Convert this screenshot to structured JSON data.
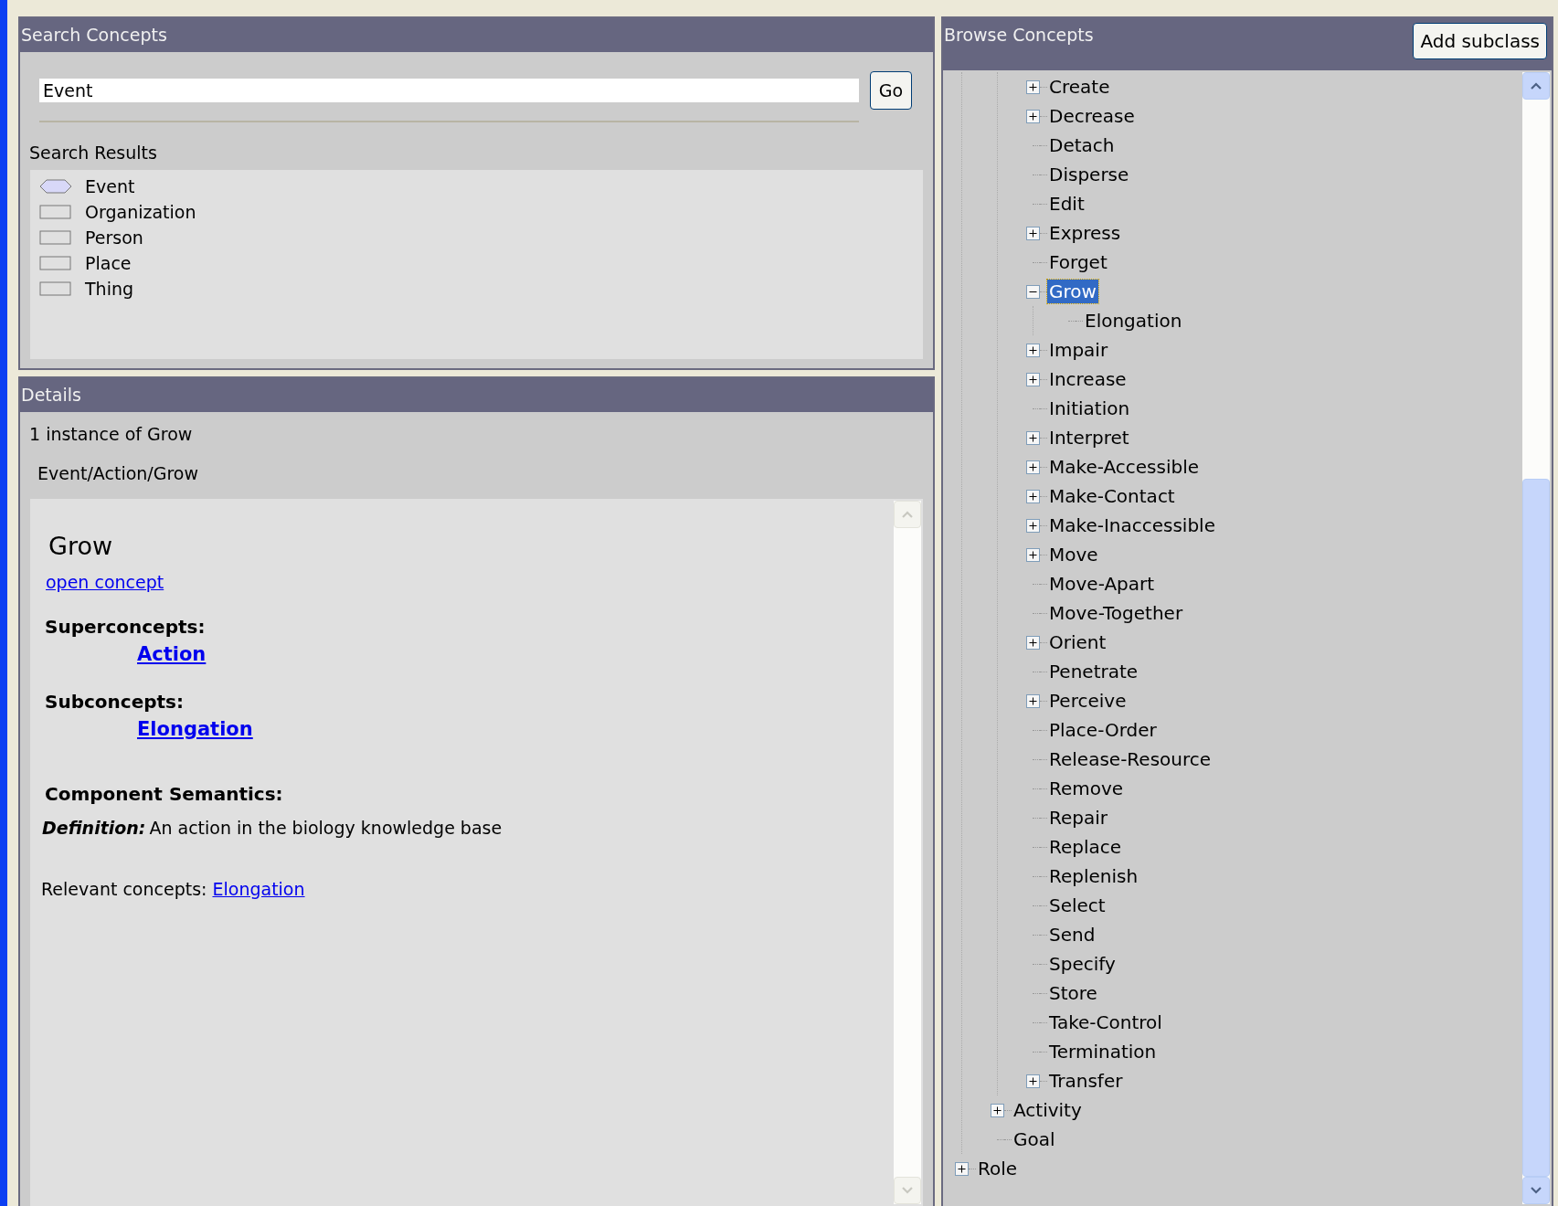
{
  "search_panel": {
    "title": "Search Concepts",
    "query": "Event",
    "go_button": "Go",
    "results_label": "Search Results",
    "results": [
      {
        "label": "Event",
        "kind": "event"
      },
      {
        "label": "Organization",
        "kind": "class"
      },
      {
        "label": "Person",
        "kind": "class"
      },
      {
        "label": "Place",
        "kind": "class"
      },
      {
        "label": "Thing",
        "kind": "class"
      }
    ]
  },
  "details_panel": {
    "title": "Details",
    "instance_count": "1 instance of Grow",
    "path": "Event/Action/Grow",
    "concept": {
      "name": "Grow",
      "open_link": "open concept",
      "superconcepts_label": "Superconcepts:",
      "superconcepts": [
        "Action"
      ],
      "subconcepts_label": "Subconcepts:",
      "subconcepts": [
        "Elongation"
      ],
      "semantics_label": "Component Semantics:",
      "definition_label": "Definition:",
      "definition": "An action in the biology knowledge base",
      "relevant_label": "Relevant concepts:",
      "relevant": [
        "Elongation"
      ]
    }
  },
  "browse_panel": {
    "title": "Browse Concepts",
    "add_button": "Add subclass",
    "tree": [
      {
        "children": [
          {
            "children": [
              {
                "label": "Create",
                "kind": "branch",
                "expanded": false,
                "selected": false
              },
              {
                "label": "Decrease",
                "kind": "branch",
                "expanded": false,
                "selected": false
              },
              {
                "label": "Detach",
                "kind": "leaf",
                "selected": false
              },
              {
                "label": "Disperse",
                "kind": "leaf",
                "selected": false
              },
              {
                "label": "Edit",
                "kind": "leaf",
                "selected": false
              },
              {
                "label": "Express",
                "kind": "branch",
                "expanded": false,
                "selected": false
              },
              {
                "label": "Forget",
                "kind": "leaf",
                "selected": false
              },
              {
                "label": "Grow",
                "kind": "branch",
                "expanded": true,
                "selected": true,
                "children": [
                  {
                    "label": "Elongation",
                    "kind": "leaf",
                    "selected": false
                  }
                ]
              },
              {
                "label": "Impair",
                "kind": "branch",
                "expanded": false,
                "selected": false
              },
              {
                "label": "Increase",
                "kind": "branch",
                "expanded": false,
                "selected": false
              },
              {
                "label": "Initiation",
                "kind": "leaf",
                "selected": false
              },
              {
                "label": "Interpret",
                "kind": "branch",
                "expanded": false,
                "selected": false
              },
              {
                "label": "Make-Accessible",
                "kind": "branch",
                "expanded": false,
                "selected": false
              },
              {
                "label": "Make-Contact",
                "kind": "branch",
                "expanded": false,
                "selected": false
              },
              {
                "label": "Make-Inaccessible",
                "kind": "branch",
                "expanded": false,
                "selected": false
              },
              {
                "label": "Move",
                "kind": "branch",
                "expanded": false,
                "selected": false
              },
              {
                "label": "Move-Apart",
                "kind": "leaf",
                "selected": false
              },
              {
                "label": "Move-Together",
                "kind": "leaf",
                "selected": false
              },
              {
                "label": "Orient",
                "kind": "branch",
                "expanded": false,
                "selected": false
              },
              {
                "label": "Penetrate",
                "kind": "leaf",
                "selected": false
              },
              {
                "label": "Perceive",
                "kind": "branch",
                "expanded": false,
                "selected": false
              },
              {
                "label": "Place-Order",
                "kind": "leaf",
                "selected": false
              },
              {
                "label": "Release-Resource",
                "kind": "leaf",
                "selected": false
              },
              {
                "label": "Remove",
                "kind": "leaf",
                "selected": false
              },
              {
                "label": "Repair",
                "kind": "leaf",
                "selected": false
              },
              {
                "label": "Replace",
                "kind": "leaf",
                "selected": false
              },
              {
                "label": "Replenish",
                "kind": "leaf",
                "selected": false
              },
              {
                "label": "Select",
                "kind": "leaf",
                "selected": false
              },
              {
                "label": "Send",
                "kind": "leaf",
                "selected": false
              },
              {
                "label": "Specify",
                "kind": "leaf",
                "selected": false
              },
              {
                "label": "Store",
                "kind": "leaf",
                "selected": false
              },
              {
                "label": "Take-Control",
                "kind": "leaf",
                "selected": false
              },
              {
                "label": "Termination",
                "kind": "leaf",
                "selected": false
              },
              {
                "label": "Transfer",
                "kind": "branch",
                "expanded": false,
                "selected": false
              }
            ]
          },
          {
            "label": "Activity",
            "kind": "branch",
            "expanded": false,
            "selected": false
          },
          {
            "label": "Goal",
            "kind": "leaf",
            "selected": false
          }
        ]
      },
      {
        "label": "Role",
        "kind": "branch",
        "expanded": false,
        "selected": false
      }
    ]
  }
}
